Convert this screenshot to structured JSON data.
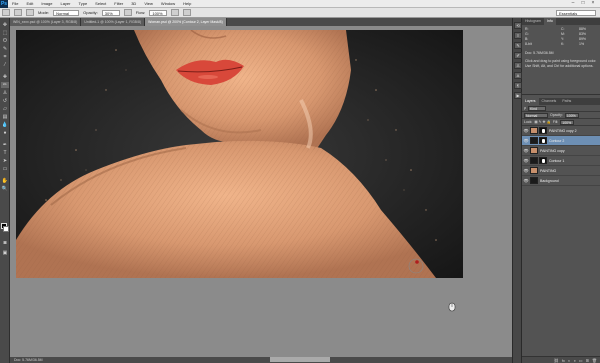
{
  "menubar": {
    "logo": "Ps",
    "items": [
      "File",
      "Edit",
      "Image",
      "Layer",
      "Type",
      "Select",
      "Filter",
      "3D",
      "View",
      "Window",
      "Help"
    ],
    "controls": [
      "–",
      "□",
      "×"
    ]
  },
  "options": {
    "mode_label": "Mode:",
    "mode_value": "Normal",
    "opacity_label": "Opacity:",
    "opacity_value": "30%",
    "flow_label": "Flow:",
    "flow_value": "100%",
    "workspace_value": "Essentials"
  },
  "tabs": [
    {
      "label": "WIN_xxxx.psd @ 100% (Layer 3, RGB/8)",
      "active": false
    },
    {
      "label": "Untitled-1 @ 100% (Layer 1, RGB/8)",
      "active": false
    },
    {
      "label": "Woman.psd @ 200% (Contour 2, Layer Mask/8)",
      "active": true
    }
  ],
  "status": {
    "doc": "Doc: 5.76M/36.5M"
  },
  "panels": {
    "top_tabs": [
      "Histogram",
      "Info"
    ],
    "info": {
      "row1": [
        "R:",
        "",
        "C:",
        "88%"
      ],
      "row2": [
        "G:",
        "",
        "M:",
        "83%"
      ],
      "row3": [
        "B:",
        "",
        "Y:",
        "89%"
      ],
      "row4": [
        "8-bit",
        "",
        "K:",
        "1%"
      ],
      "doc": "Doc: 5.76M/36.5M",
      "hint": "Click and drag to paint using foreground color. Use Shift, Alt, and Ctrl for additional options."
    },
    "layer_tabs": [
      "Layers",
      "Channels",
      "Paths"
    ],
    "kind_label": "Kind",
    "blend_value": "Normal",
    "opacity_label": "Opacity:",
    "opacity_value": "100%",
    "lock_label": "Lock:",
    "fill_label": "Fill:",
    "fill_value": "100%",
    "layers": [
      {
        "name": "PAINTING copy 2",
        "thumb": "skin",
        "mask": true,
        "selected": false
      },
      {
        "name": "Contour 2",
        "thumb": "dark",
        "mask": true,
        "selected": true
      },
      {
        "name": "PAINTING copy",
        "thumb": "skin",
        "mask": false,
        "selected": false
      },
      {
        "name": "Contour 1",
        "thumb": "dark",
        "mask": true,
        "selected": false
      },
      {
        "name": "PAINTING",
        "thumb": "skin",
        "mask": false,
        "selected": false
      },
      {
        "name": "Background",
        "thumb": "dark",
        "mask": false,
        "selected": false
      }
    ]
  },
  "colors": {
    "accent_selected": "#6d8fb4",
    "fg": "#000000",
    "bg": "#ffffff",
    "lips": "#d8483a"
  }
}
